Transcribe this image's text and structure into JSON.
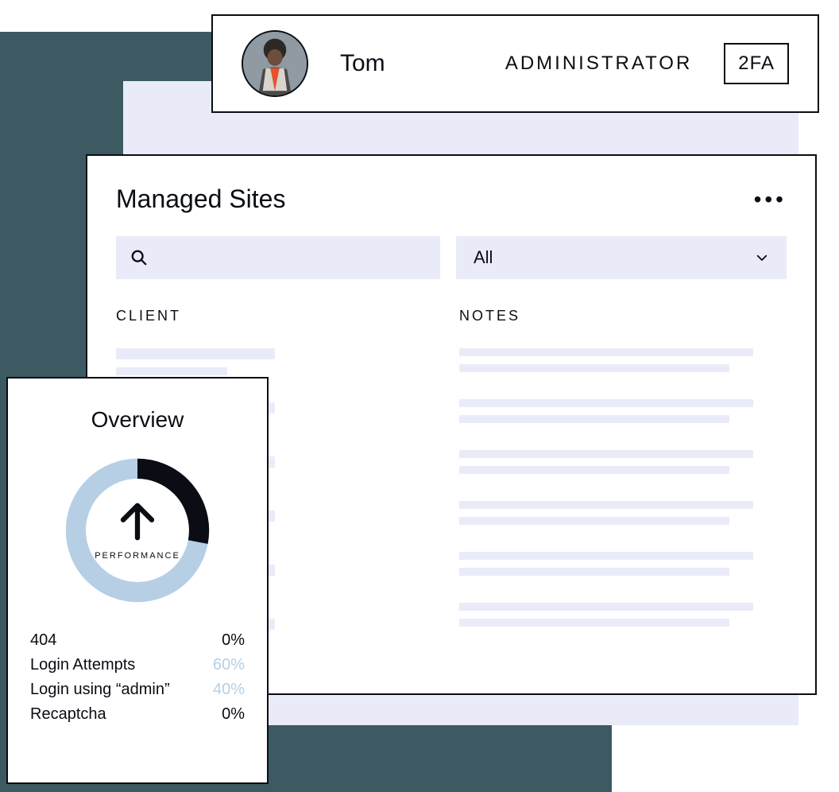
{
  "user": {
    "name": "Tom",
    "role": "ADMINISTRATOR",
    "badge": "2FA"
  },
  "sites": {
    "title": "Managed Sites",
    "filter_selected": "All",
    "columns": {
      "client": "CLIENT",
      "notes": "NOTES"
    }
  },
  "overview": {
    "title": "Overview",
    "gauge_label": "PERFORMANCE",
    "stats": [
      {
        "label": "404",
        "value": "0%",
        "muted": false
      },
      {
        "label": "Login Attempts",
        "value": "60%",
        "muted": true
      },
      {
        "label": "Login using “admin”",
        "value": "40%",
        "muted": true
      },
      {
        "label": "Recaptcha",
        "value": "0%",
        "muted": false
      }
    ]
  },
  "chart_data": {
    "type": "pie",
    "title": "Performance",
    "series": [
      {
        "name": "light",
        "value": 72,
        "color": "#b6cfe5"
      },
      {
        "name": "dark",
        "value": 28,
        "color": "#0a0d14"
      }
    ]
  }
}
